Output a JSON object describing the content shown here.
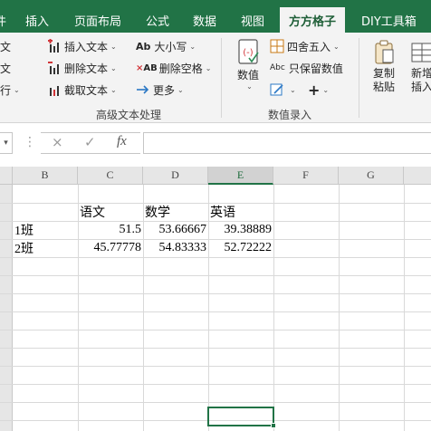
{
  "tabs": [
    {
      "label": "件"
    },
    {
      "label": "插入"
    },
    {
      "label": "页面布局"
    },
    {
      "label": "公式"
    },
    {
      "label": "数据"
    },
    {
      "label": "视图"
    },
    {
      "label": "方方格子"
    },
    {
      "label": "DIY工具箱"
    }
  ],
  "active_tab": "方方格子",
  "ribbon": {
    "left_partial": [
      "文",
      "文",
      "行"
    ],
    "col1": [
      {
        "label": "插入文本"
      },
      {
        "label": "删除文本"
      },
      {
        "label": "截取文本"
      }
    ],
    "col2": [
      {
        "label": "大小写"
      },
      {
        "label": "删除空格"
      },
      {
        "label": "更多"
      }
    ],
    "col2_icon_text": [
      "Ab",
      "AB"
    ],
    "group1_label": "高级文本处理",
    "numeric_big_label": "数值",
    "col3": [
      {
        "label": "四舍五入"
      },
      {
        "label": "只保留数值"
      }
    ],
    "abc_text": "Abc",
    "group2_label": "数值录入",
    "copy_paste_label": "复制粘贴",
    "new_label": "新增插入"
  },
  "formula_bar": {
    "cancel_icon": "×",
    "confirm_icon": "✓",
    "fx_label": "fx",
    "value": ""
  },
  "columns": [
    "B",
    "C",
    "D",
    "E",
    "F",
    "G"
  ],
  "selected_column": "E",
  "rows": [
    [
      "",
      "",
      "",
      "",
      "",
      ""
    ],
    [
      "",
      "",
      "",
      "",
      "",
      ""
    ],
    [
      "",
      "语文",
      "数学",
      "英语",
      "",
      ""
    ],
    [
      "1班",
      "51.5",
      "53.66667",
      "39.38889",
      "",
      ""
    ],
    [
      "2班",
      "45.77778",
      "54.83333",
      "52.72222",
      "",
      ""
    ]
  ],
  "colors": {
    "brand_green": "#217346",
    "ribbon_bg": "#f3f3f3",
    "header_bg": "#e6e6e6"
  }
}
